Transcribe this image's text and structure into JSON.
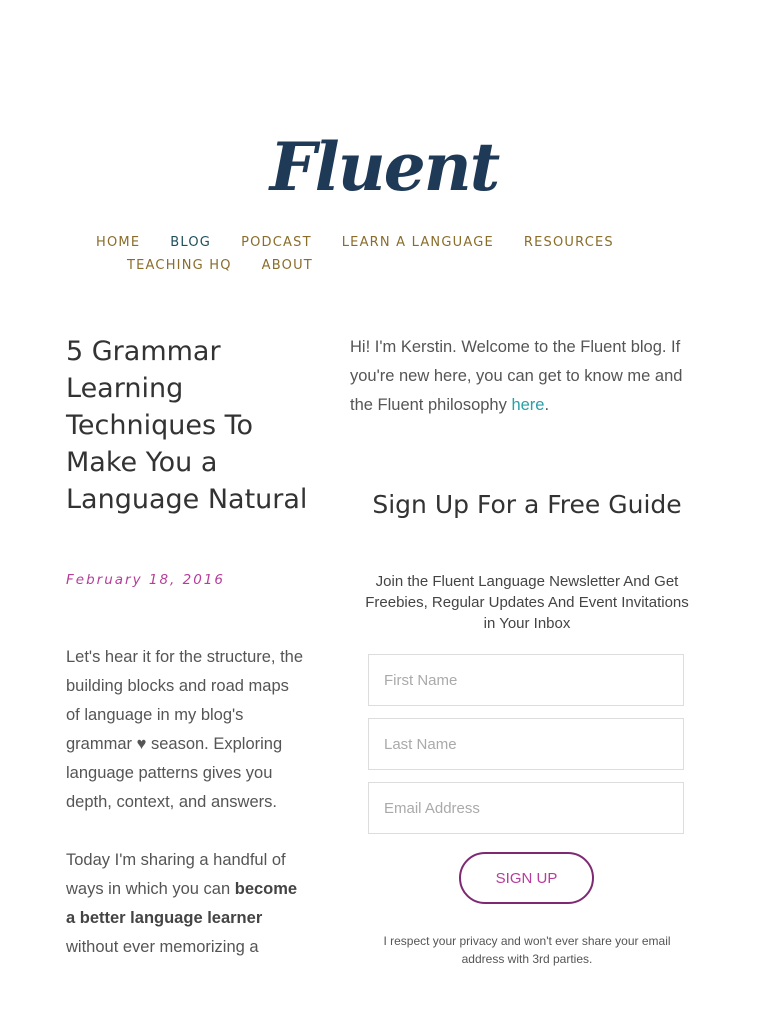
{
  "site": {
    "logo_text": "Fluent"
  },
  "nav": {
    "row1": [
      "HOME",
      "BLOG",
      "PODCAST",
      "LEARN A LANGUAGE",
      "RESOURCES"
    ],
    "row2": [
      "TEACHING HQ",
      "ABOUT"
    ],
    "active": "BLOG"
  },
  "post": {
    "title": "5 Grammar Learning Techniques To Make You a Language Natural",
    "date": "February 18, 2016",
    "para1": "Let's hear it for the structure, the building blocks and road maps of language in my blog's grammar ♥ season. Exploring language patterns gives you depth, context, and answers.",
    "para2_start": "Today I'm sharing a handful of ways in which you can ",
    "para2_bold": "become a better language learner",
    "para2_end": " without ever memorizing a"
  },
  "sidebar": {
    "intro_text": "Hi! I'm Kerstin. Welcome to the Fluent blog. If you're new here, you can get to know me and the Fluent philosophy ",
    "intro_link": "here",
    "intro_end": ".",
    "signup_title": "Sign Up For a Free Guide",
    "signup_subtitle": "Join the Fluent Language Newsletter And Get Freebies, Regular Updates And Event Invitations in Your Inbox",
    "first_name_placeholder": "First Name",
    "last_name_placeholder": "Last Name",
    "email_placeholder": "Email Address",
    "button_label": "SIGN UP",
    "privacy_text": "I respect your privacy and won't ever share your email address with 3rd parties."
  },
  "colors": {
    "logo": "#1f3a57",
    "nav": "#8a6d2a",
    "nav_active": "#1f4f5c",
    "date": "#b63d9a",
    "link": "#2aa0a8",
    "button_border": "#7d2a72"
  }
}
